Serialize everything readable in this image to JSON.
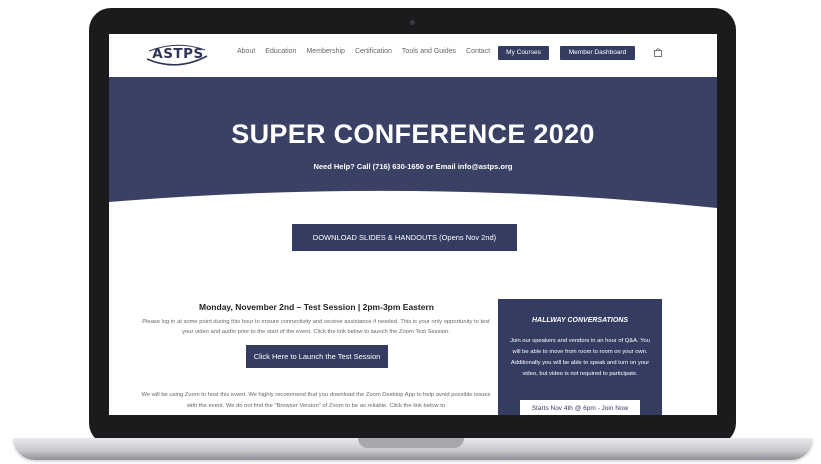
{
  "header": {
    "logo_text": "ASTPS",
    "nav": [
      "About",
      "Education",
      "Membership",
      "Certification",
      "Tools and Guides",
      "Contact"
    ],
    "my_courses": "My Courses",
    "member_dashboard": "Member Dashboard"
  },
  "hero": {
    "title": "SUPER CONFERENCE 2020",
    "subtitle": "Need Help? Call (716) 630-1650 or Email info@astps.org"
  },
  "download_button": "DOWNLOAD SLIDES & HANDOUTS (Opens Nov 2nd)",
  "session": {
    "title": "Monday, November 2nd – Test Session | 2pm-3pm Eastern",
    "text": "Please log in at some point during this hour to ensure connectivity and receive assistance if needed. This is your only opportunity to test your video and audio prior to the start of the event. Click the link below to launch the Zoom Test Session.",
    "launch_button": "Click Here to Launch the Test Session",
    "zoom_text": "We will be using Zoom to host this event. We highly recommend that you download the Zoom Desktop App to help avoid possible issues with the event. We do not find the \"Browser Version\" of Zoom to be as reliable. Click the link below to"
  },
  "card": {
    "title": "HALLWAY CONVERSATIONS",
    "text": "Join our speakers and vendors in an hour of Q&A. You will be able to move from room to room on your own. Additionally you will be able to speak and turn on your video, but video is not required to participate.",
    "button": "Starts Nov 4th @ 6pm - Join Now"
  },
  "colors": {
    "brand": "#353c61",
    "laptop_bezel": "#1b1b1d"
  }
}
